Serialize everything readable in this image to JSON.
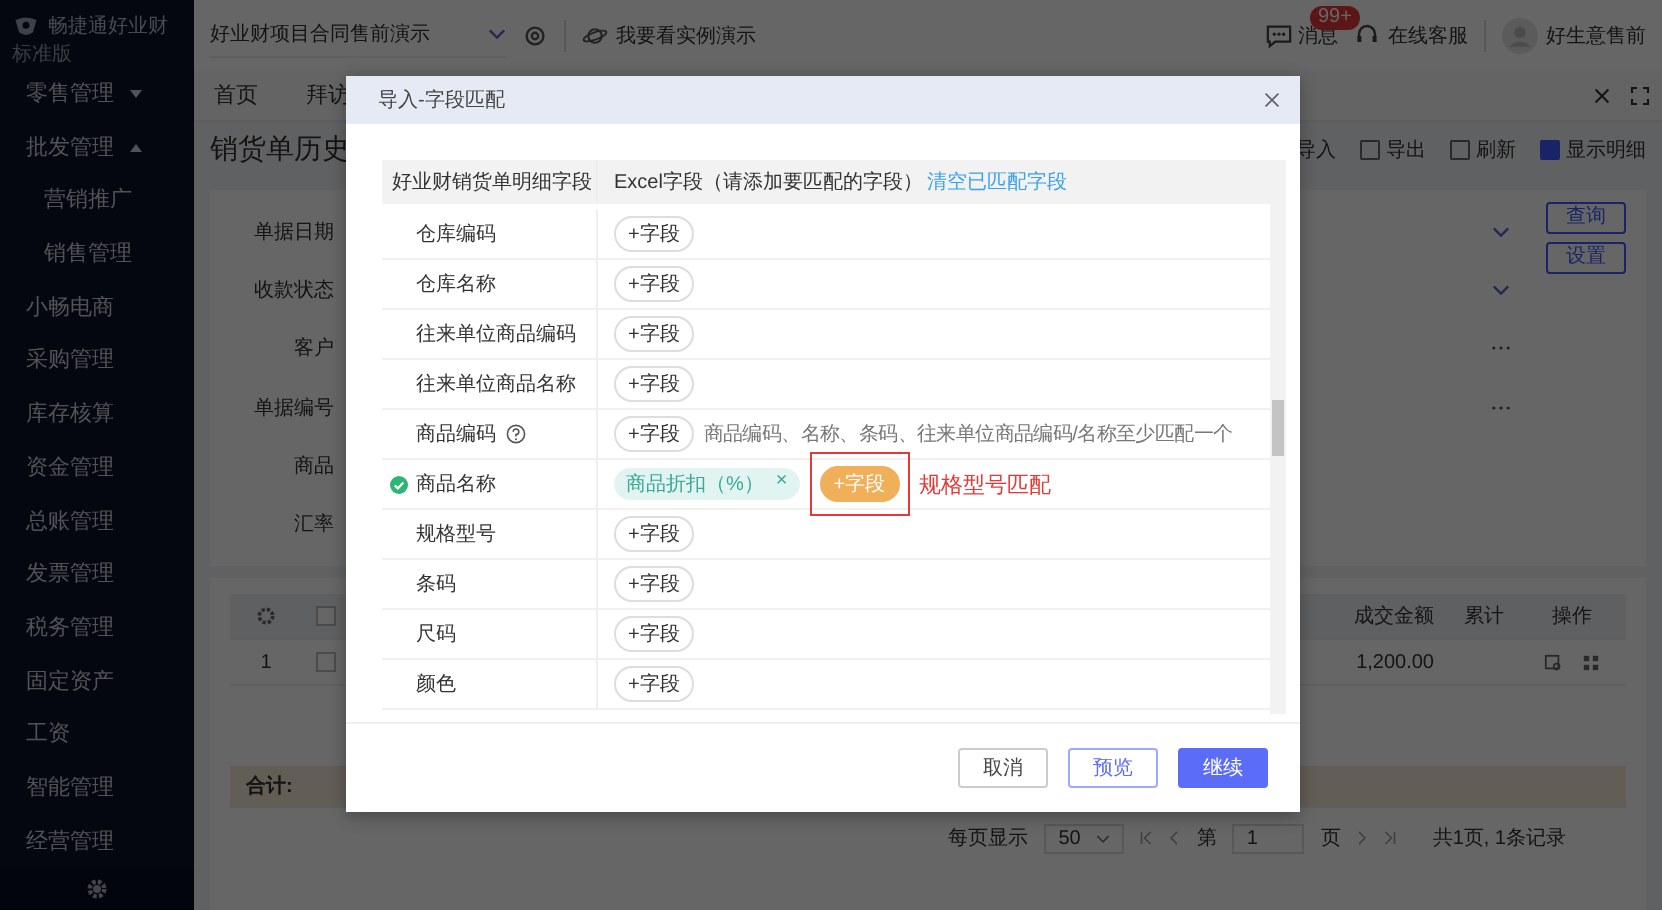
{
  "sidebar": {
    "logo": "畅捷通好业财",
    "edition": "标准版",
    "items": [
      {
        "label": "零售管理",
        "expanded": false
      },
      {
        "label": "批发管理",
        "expanded": true,
        "children": [
          {
            "label": "营销推广"
          },
          {
            "label": "销售管理"
          }
        ]
      },
      {
        "label": "小畅电商"
      },
      {
        "label": "采购管理"
      },
      {
        "label": "库存核算"
      },
      {
        "label": "资金管理"
      },
      {
        "label": "总账管理"
      },
      {
        "label": "发票管理"
      },
      {
        "label": "税务管理"
      },
      {
        "label": "固定资产"
      },
      {
        "label": "工资"
      },
      {
        "label": "智能管理"
      },
      {
        "label": "经营管理"
      }
    ]
  },
  "topbar": {
    "company": "好业财项目合同售前演示",
    "demo_link": "我要看实例演示",
    "messages": {
      "label": "消息",
      "badge": "99+"
    },
    "support": "在线客服",
    "user": "好生意售前"
  },
  "tabs": [
    {
      "label": "首页",
      "selected": false
    },
    {
      "label": "拜访",
      "selected": false
    }
  ],
  "page": {
    "title": "销货单历史",
    "actions": [
      "导入",
      "导出",
      "刷新"
    ],
    "show_detail": {
      "label": "显示明细",
      "checked": true
    },
    "filters": [
      {
        "label": "单据日期",
        "kind": "select"
      },
      {
        "label": "收款状态",
        "kind": "select"
      },
      {
        "label": "客户",
        "kind": "picker"
      },
      {
        "label": "单据编号",
        "kind": "picker"
      },
      {
        "label": "商品",
        "kind": "text"
      },
      {
        "label": "汇率",
        "kind": "text"
      }
    ],
    "buttons": [
      "查询",
      "设置"
    ],
    "table": {
      "header_checked": false,
      "columns": [
        "成交金额",
        "累计",
        "操作"
      ],
      "rows": [
        {
          "index": "1",
          "checked": false,
          "amount": "1,200.00"
        }
      ],
      "total_label": "合计:"
    },
    "pagination": {
      "per_page_label": "每页显示",
      "per_page": "50",
      "page_prefix": "第",
      "page": "1",
      "page_suffix": "页",
      "summary": "共1页, 1条记录"
    }
  },
  "modal": {
    "title": "导入-字段匹配",
    "columns": [
      "好业财销货单明细字段",
      "Excel字段（请添加要匹配的字段）"
    ],
    "clear_link": "清空已匹配字段",
    "rows": [
      {
        "field": "仓库编码",
        "matched": false,
        "help": false,
        "add": "+字段",
        "highlighted": false
      },
      {
        "field": "仓库名称",
        "matched": false,
        "help": false,
        "add": "+字段",
        "highlighted": false
      },
      {
        "field": "往来单位商品编码",
        "matched": false,
        "help": false,
        "add": "+字段",
        "highlighted": false
      },
      {
        "field": "往来单位商品名称",
        "matched": false,
        "help": false,
        "add": "+字段",
        "highlighted": false
      },
      {
        "field": "商品编码",
        "matched": false,
        "help": true,
        "add": "+字段",
        "highlighted": false,
        "hint": "商品编码、名称、条码、往来单位商品编码/名称至少匹配一个"
      },
      {
        "field": "商品名称",
        "matched": true,
        "help": false,
        "tags": [
          {
            "label": "商品折扣（%）",
            "remove": "×"
          }
        ],
        "add": "+字段",
        "highlighted": true,
        "annotation": "规格型号匹配"
      },
      {
        "field": "规格型号",
        "matched": false,
        "help": false,
        "add": "+字段",
        "highlighted": false
      },
      {
        "field": "条码",
        "matched": false,
        "help": false,
        "add": "+字段",
        "highlighted": false
      },
      {
        "field": "尺码",
        "matched": false,
        "help": false,
        "add": "+字段",
        "highlighted": false
      },
      {
        "field": "颜色",
        "matched": false,
        "help": false,
        "add": "+字段",
        "highlighted": false
      }
    ],
    "buttons": [
      {
        "label": "取消",
        "kind": "default"
      },
      {
        "label": "预览",
        "kind": "outline"
      },
      {
        "label": "继续",
        "kind": "primary"
      }
    ]
  }
}
